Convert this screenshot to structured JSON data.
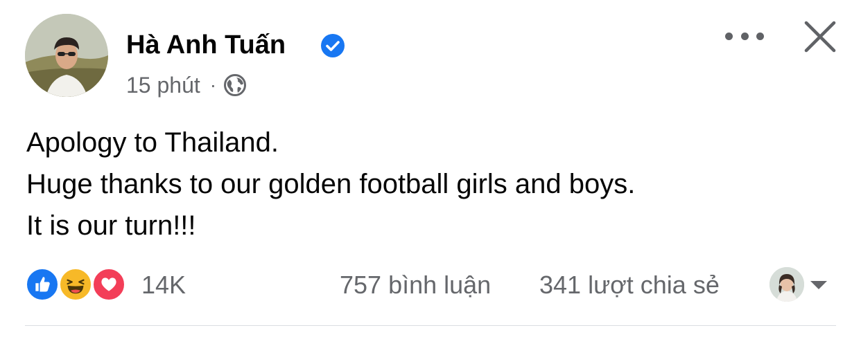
{
  "post": {
    "author": {
      "name": "Hà Anh Tuấn",
      "verified": true,
      "avatar_icon": "person-avatar"
    },
    "meta": {
      "time": "15 phút",
      "separator": "·",
      "privacy_icon": "globe-icon"
    },
    "header_actions": {
      "more_icon": "more-horizontal-icon",
      "close_icon": "close-icon"
    },
    "text_lines": [
      "Apology to Thailand.",
      "Huge thanks to our golden football girls and boys.",
      "It is our turn!!!"
    ],
    "stats": {
      "reaction_icons": [
        "like-icon",
        "haha-icon",
        "love-icon"
      ],
      "reaction_count": "14K",
      "comments": "757 bình luận",
      "shares": "341 lượt chia sẻ"
    }
  },
  "colors": {
    "primary_text": "#050505",
    "secondary_text": "#65676b",
    "verified_blue": "#1877f2",
    "like_blue": "#1877f2",
    "haha_yellow": "#f7b928",
    "love_red": "#f33e58",
    "divider": "#dadde1"
  }
}
